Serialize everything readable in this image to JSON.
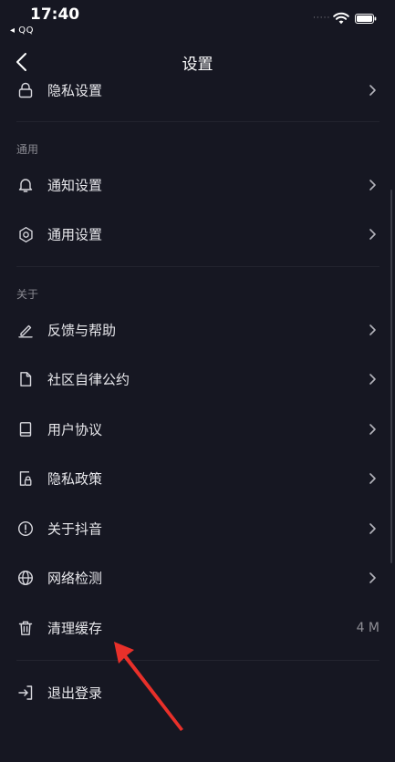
{
  "status_bar": {
    "time": "17:40",
    "back_app": "◂ QQ",
    "signal": "·····"
  },
  "nav": {
    "title": "设置"
  },
  "sections": {
    "general_title": "通用",
    "about_title": "关于"
  },
  "items": {
    "privacy_settings": "隐私设置",
    "notification_settings": "通知设置",
    "general_settings": "通用设置",
    "feedback_help": "反馈与帮助",
    "community_rules": "社区自律公约",
    "user_agreement": "用户协议",
    "privacy_policy": "隐私政策",
    "about_app": "关于抖音",
    "network_check": "网络检测",
    "clear_cache": "清理缓存",
    "clear_cache_value": "4 M",
    "logout": "退出登录"
  },
  "colors": {
    "background": "#161722",
    "annotation_arrow": "#e8302a"
  }
}
